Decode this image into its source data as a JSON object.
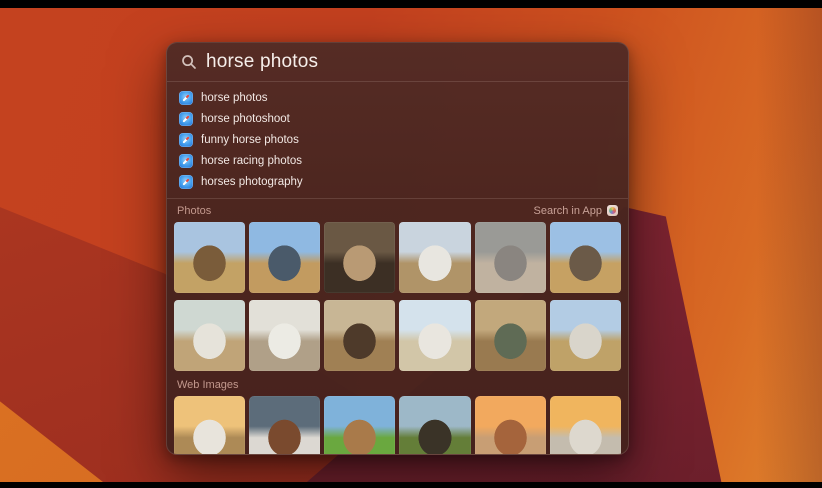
{
  "search": {
    "value": "horse photos",
    "icon": "search-icon"
  },
  "suggestions": [
    {
      "label": "horse photos"
    },
    {
      "label": "horse photoshoot"
    },
    {
      "label": "funny horse photos"
    },
    {
      "label": "horse racing photos"
    },
    {
      "label": "horses photography"
    }
  ],
  "photos_section": {
    "title": "Photos",
    "action_label": "Search in App",
    "action_icon": "photos-app-icon",
    "thumbs": [
      {
        "alt": "person with horse in hay field",
        "top": "#a9c4e0",
        "bottom": "#c3a265",
        "subject": "#7a5c3a"
      },
      {
        "alt": "child in cowboy hat riding horse",
        "top": "#8fb9e2",
        "bottom": "#c29b60",
        "subject": "#4a5a6a"
      },
      {
        "alt": "horse head in barn",
        "top": "#6a5844",
        "bottom": "#3c2f24",
        "subject": "#b99a74"
      },
      {
        "alt": "rider on white horse in hills",
        "top": "#c9d4de",
        "bottom": "#b09468",
        "subject": "#e8e6e0"
      },
      {
        "alt": "gray horse with girl close-up",
        "top": "#9a9a96",
        "bottom": "#c0b2a0",
        "subject": "#8a8580"
      },
      {
        "alt": "horse grazing beside child in hat",
        "top": "#9cc0e4",
        "bottom": "#c6a163",
        "subject": "#6b5a48"
      },
      {
        "alt": "girl hugging white horse",
        "top": "#cfd8d2",
        "bottom": "#c0a478",
        "subject": "#e6e3da"
      },
      {
        "alt": "girl petting white horse",
        "top": "#e2e0d8",
        "bottom": "#b0a088",
        "subject": "#ecebe4"
      },
      {
        "alt": "dark horse with child",
        "top": "#c8b695",
        "bottom": "#a08054",
        "subject": "#4e3a2a"
      },
      {
        "alt": "child riding white horse",
        "top": "#d4e2ec",
        "bottom": "#d2c6a8",
        "subject": "#e9e6df"
      },
      {
        "alt": "child in hat leading horse",
        "top": "#c2a87c",
        "bottom": "#997a50",
        "subject": "#5f6b55"
      },
      {
        "alt": "rider on horse in open field",
        "top": "#b3cce4",
        "bottom": "#bfa268",
        "subject": "#d9d5cb"
      }
    ]
  },
  "web_images_section": {
    "title": "Web Images",
    "thumbs": [
      {
        "alt": "white horses running through surf at sunset",
        "top": "#eec27a",
        "bottom": "#ad8a56",
        "subject": "#e8e4dc"
      },
      {
        "alt": "bay horse galloping under stormy sky",
        "top": "#5c6c7a",
        "bottom": "#dcd8d2",
        "subject": "#7a4a2e"
      },
      {
        "alt": "horses running on green grass",
        "top": "#7fb2da",
        "bottom": "#6aa83f",
        "subject": "#a97a4a"
      },
      {
        "alt": "herd of horses in green valley",
        "top": "#9db8c8",
        "bottom": "#647e38",
        "subject": "#3a3327"
      },
      {
        "alt": "horses on sunset beach",
        "top": "#f2a95e",
        "bottom": "#c89e74",
        "subject": "#a5643c"
      },
      {
        "alt": "white horses at golden sunset",
        "top": "#f0b55e",
        "bottom": "#c4bcae",
        "subject": "#ddd8ce"
      }
    ]
  },
  "colors": {
    "window_bg": "#492520",
    "window_text": "#f2e8e4",
    "section_header_text": "#c2988d",
    "safari_icon_blue": "#2f8df0",
    "wallpaper_orange": "#cd501f",
    "wallpaper_dark_red": "#a23120",
    "wallpaper_maroon": "#7b2330",
    "letterbox": "#000000"
  }
}
